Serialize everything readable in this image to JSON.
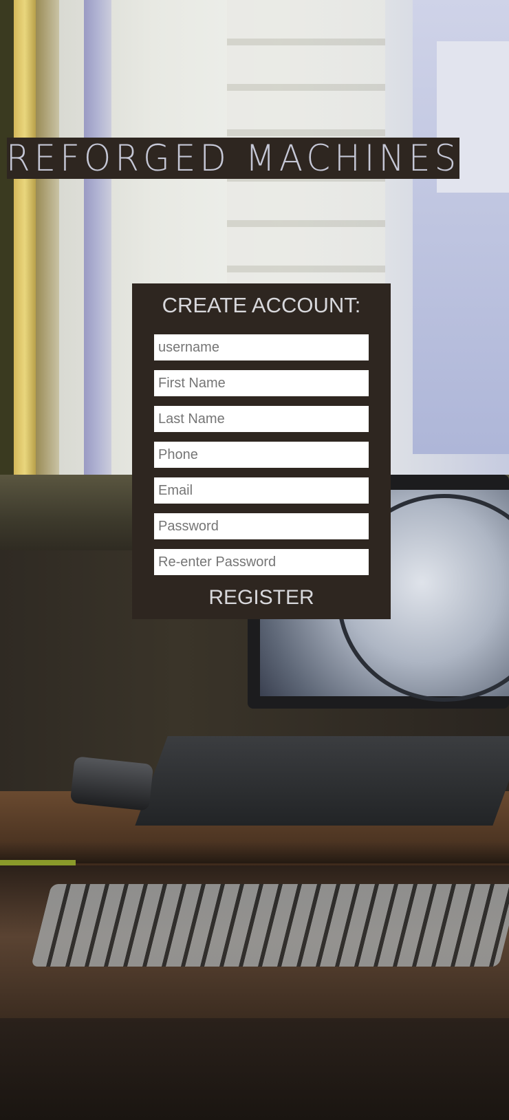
{
  "brand": {
    "logo_text": "REFORGED MACHINES"
  },
  "form": {
    "title": "CREATE ACCOUNT:",
    "fields": [
      {
        "placeholder": "username",
        "value": ""
      },
      {
        "placeholder": "First Name",
        "value": ""
      },
      {
        "placeholder": "Last Name",
        "value": ""
      },
      {
        "placeholder": "Phone",
        "value": ""
      },
      {
        "placeholder": "Email",
        "value": ""
      },
      {
        "placeholder": "Password",
        "value": ""
      },
      {
        "placeholder": "Re-enter Password",
        "value": ""
      }
    ],
    "submit_label": "REGISTER"
  },
  "colors": {
    "panel_bg": "#2e2620",
    "logo_text": "#c5c7d6",
    "title_text": "#d8d8dc"
  }
}
